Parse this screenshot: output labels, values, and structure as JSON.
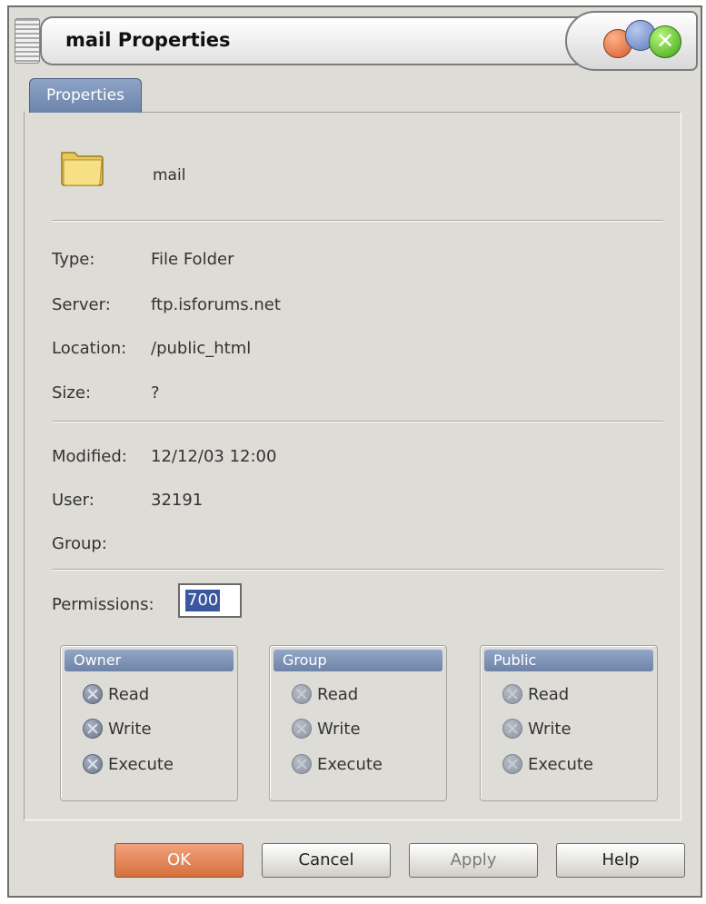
{
  "window": {
    "title": "mail Properties"
  },
  "tabs": [
    {
      "label": "Properties",
      "active": true
    }
  ],
  "item": {
    "name": "mail",
    "icon": "folder-icon"
  },
  "details": {
    "type": {
      "label": "Type:",
      "value": "File Folder"
    },
    "server": {
      "label": "Server:",
      "value": "ftp.isforums.net"
    },
    "location": {
      "label": "Location:",
      "value": "/public_html"
    },
    "size": {
      "label": "Size:",
      "value": "?"
    },
    "modified": {
      "label": "Modified:",
      "value": "12/12/03 12:00"
    },
    "user": {
      "label": "User:",
      "value": "32191"
    },
    "group": {
      "label": "Group:",
      "value": ""
    }
  },
  "permissions": {
    "label": "Permissions:",
    "value": "700",
    "groups": [
      {
        "title": "Owner",
        "items": [
          {
            "label": "Read",
            "checked": true
          },
          {
            "label": "Write",
            "checked": true
          },
          {
            "label": "Execute",
            "checked": true
          }
        ]
      },
      {
        "title": "Group",
        "items": [
          {
            "label": "Read",
            "checked": false
          },
          {
            "label": "Write",
            "checked": false
          },
          {
            "label": "Execute",
            "checked": false
          }
        ]
      },
      {
        "title": "Public",
        "items": [
          {
            "label": "Read",
            "checked": false
          },
          {
            "label": "Write",
            "checked": false
          },
          {
            "label": "Execute",
            "checked": false
          }
        ]
      }
    ]
  },
  "buttons": {
    "ok": "OK",
    "cancel": "Cancel",
    "apply": "Apply",
    "help": "Help"
  },
  "colors": {
    "ok_button": "#d4703f",
    "tab_blue": "#7d93b8",
    "selection": "#3a57a0"
  }
}
